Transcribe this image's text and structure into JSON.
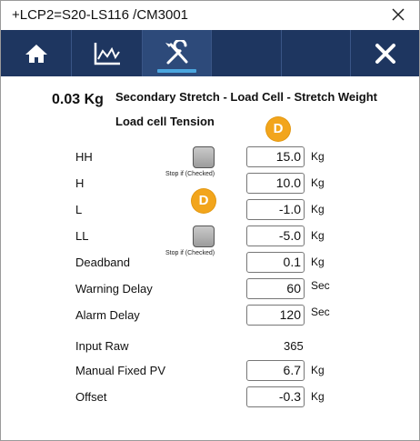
{
  "window": {
    "title": "+LCP2=S20-LS116 /CM3001"
  },
  "toolbar": {
    "tabs": [
      {
        "icon": "home-icon",
        "active": false
      },
      {
        "icon": "trend-chart-icon",
        "active": false
      },
      {
        "icon": "tools-icon",
        "active": true
      },
      {
        "icon": "",
        "active": false
      },
      {
        "icon": "",
        "active": false
      },
      {
        "icon": "close-icon",
        "active": false
      }
    ]
  },
  "header": {
    "current_value": "0.03 Kg",
    "title": "Secondary Stretch - Load Cell - Stretch Weight",
    "subtitle": "Load cell Tension"
  },
  "badges": {
    "badge1": "D",
    "badge2": "D"
  },
  "rows": {
    "hh": {
      "label": "HH",
      "value": "15.0",
      "unit": "Kg"
    },
    "h": {
      "label": "H",
      "value": "10.0",
      "unit": "Kg"
    },
    "l": {
      "label": "L",
      "value": "-1.0",
      "unit": "Kg"
    },
    "ll": {
      "label": "LL",
      "value": "-5.0",
      "unit": "Kg"
    },
    "deadband": {
      "label": "Deadband",
      "value": "0.1",
      "unit": "Kg"
    },
    "warning_delay": {
      "label": "Warning Delay",
      "value": "60",
      "unit": "Sec"
    },
    "alarm_delay": {
      "label": "Alarm Delay",
      "value": "120",
      "unit": "Sec"
    },
    "input_raw": {
      "label": "Input Raw",
      "value": "365"
    },
    "manual_fixed_pv": {
      "label": "Manual Fixed PV",
      "value": "6.7",
      "unit": "Kg"
    },
    "offset": {
      "label": "Offset",
      "value": "-0.3",
      "unit": "Kg"
    }
  },
  "stop_checks": {
    "high_label": "Stop if (Checked)",
    "low_label": "Stop if (Checked)"
  },
  "colors": {
    "toolbar_bg": "#1e3660",
    "active_tab_bg": "#2d4a7a",
    "active_underline": "#4aa6df",
    "badge": "#f2a51c"
  }
}
